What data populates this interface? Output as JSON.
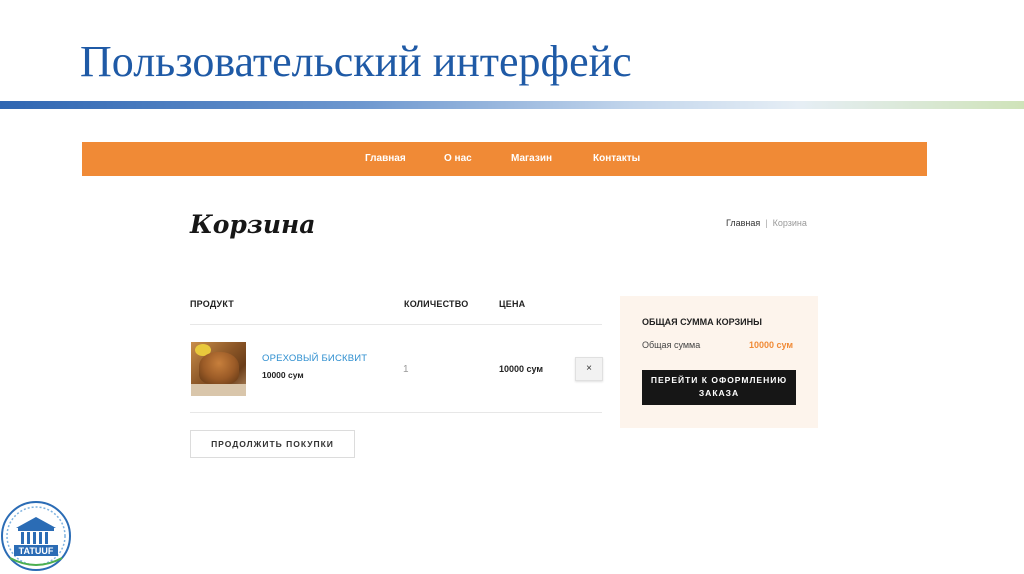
{
  "slide": {
    "title": "Пользовательский интерфейс"
  },
  "nav": {
    "items": [
      "Главная",
      "О нас",
      "Магазин",
      "Контакты"
    ]
  },
  "page": {
    "heading": "Корзина",
    "breadcrumb": {
      "home": "Главная",
      "separator": "|",
      "current": "Корзина"
    }
  },
  "cart": {
    "columns": {
      "product": "ПРОДУКТ",
      "quantity": "КОЛИЧЕСТВО",
      "price": "ЦЕНА"
    },
    "items": [
      {
        "name": "ОРЕХОВЫЙ БИСКВИТ",
        "unit_price": "10000 сум",
        "quantity": "1",
        "total": "10000 сум",
        "remove_label": "×"
      }
    ],
    "continue_label": "ПРОДОЛЖИТЬ ПОКУПКИ"
  },
  "totals": {
    "title": "ОБЩАЯ СУММА КОРЗИНЫ",
    "label": "Общая сумма",
    "value": "10000 сум",
    "checkout_label_line1": "ПЕРЕЙТИ К ОФОРМЛЕНИЮ",
    "checkout_label_line2": "ЗАКАЗА"
  },
  "logo": {
    "text": "TATUUF"
  },
  "colors": {
    "accent": "#f08a36",
    "title": "#1f5aa6",
    "link": "#2f8fd0",
    "button_dark": "#161616",
    "panel": "#fdf4ec"
  }
}
